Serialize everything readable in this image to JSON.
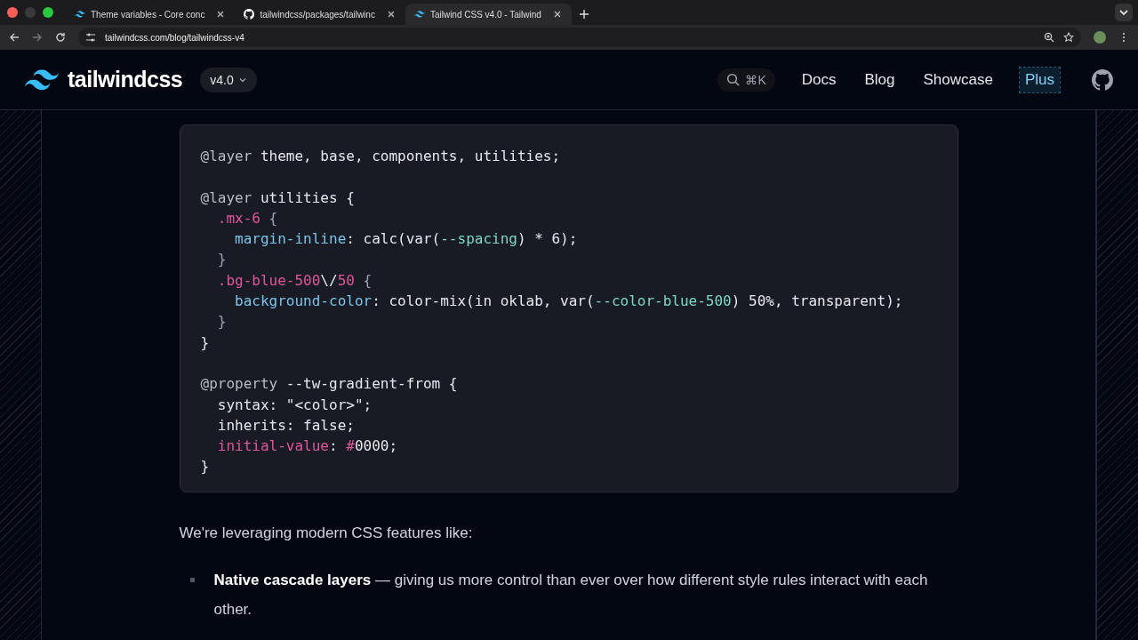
{
  "browser": {
    "tabs": [
      {
        "title": "Theme variables - Core conc",
        "kind": "tailwind",
        "selected": false
      },
      {
        "title": "tailwindcss/packages/tailwinc",
        "kind": "github",
        "selected": false
      },
      {
        "title": "Tailwind CSS v4.0 - Tailwind",
        "kind": "tailwind",
        "selected": true
      }
    ],
    "address": "tailwindcss.com/blog/tailwindcss-v4"
  },
  "header": {
    "logo": "tailwindcss",
    "version": "v4.0",
    "search_shortcut": "⌘K",
    "nav": [
      {
        "label": "Docs",
        "kind": "plain"
      },
      {
        "label": "Blog",
        "kind": "plain"
      },
      {
        "label": "Showcase",
        "kind": "plain"
      },
      {
        "label": "Plus",
        "kind": "highlight"
      }
    ]
  },
  "code_lines": [
    {
      "kind": "code",
      "tokens": [
        {
          "text": "@layer",
          "kind": "at"
        },
        {
          "text": " theme, base, components, utilities;",
          "kind": "plain"
        }
      ]
    },
    {
      "kind": "blank"
    },
    {
      "kind": "code",
      "tokens": [
        {
          "text": "@layer",
          "kind": "at"
        },
        {
          "text": " utilities {",
          "kind": "plain"
        }
      ]
    },
    {
      "kind": "code",
      "tokens": [
        {
          "text": "  .mx-6",
          "kind": "selector"
        },
        {
          "text": " {",
          "kind": "punct"
        }
      ]
    },
    {
      "kind": "code",
      "tokens": [
        {
          "text": "    margin-inline",
          "kind": "prop"
        },
        {
          "text": ": calc(var(",
          "kind": "plain"
        },
        {
          "text": "--spacing",
          "kind": "var"
        },
        {
          "text": ") * 6);",
          "kind": "plain"
        }
      ]
    },
    {
      "kind": "code",
      "tokens": [
        {
          "text": "  }",
          "kind": "punct"
        }
      ]
    },
    {
      "kind": "code",
      "tokens": [
        {
          "text": "  .bg-blue-500",
          "kind": "selector"
        },
        {
          "text": "\\/",
          "kind": "plain"
        },
        {
          "text": "50",
          "kind": "selector"
        },
        {
          "text": " {",
          "kind": "punct"
        }
      ]
    },
    {
      "kind": "code",
      "tokens": [
        {
          "text": "    background-color",
          "kind": "prop"
        },
        {
          "text": ": color-mix(in oklab, var(",
          "kind": "plain"
        },
        {
          "text": "--color-blue-500",
          "kind": "var"
        },
        {
          "text": ") 50%, transparent);",
          "kind": "plain"
        }
      ]
    },
    {
      "kind": "code",
      "tokens": [
        {
          "text": "  }",
          "kind": "punct"
        }
      ]
    },
    {
      "kind": "code",
      "tokens": [
        {
          "text": "}",
          "kind": "plain"
        }
      ]
    },
    {
      "kind": "blank"
    },
    {
      "kind": "code",
      "tokens": [
        {
          "text": "@property",
          "kind": "at"
        },
        {
          "text": " --tw-gradient-from {",
          "kind": "plain"
        }
      ]
    },
    {
      "kind": "code",
      "tokens": [
        {
          "text": "  syntax: \"<color>\";",
          "kind": "plain"
        }
      ]
    },
    {
      "kind": "code",
      "tokens": [
        {
          "text": "  inherits: false;",
          "kind": "plain"
        }
      ]
    },
    {
      "kind": "code",
      "tokens": [
        {
          "text": "  initial-value",
          "kind": "selector"
        },
        {
          "text": ": ",
          "kind": "plain"
        },
        {
          "text": "#",
          "kind": "selector"
        },
        {
          "text": "0000;",
          "kind": "plain"
        }
      ]
    },
    {
      "kind": "code",
      "tokens": [
        {
          "text": "}",
          "kind": "plain"
        }
      ]
    }
  ],
  "paragraph": "We're leveraging modern CSS features like:",
  "list": [
    {
      "text": "**Native cascade layers** — giving us more control than ever over how different style rules interact with each other."
    }
  ]
}
